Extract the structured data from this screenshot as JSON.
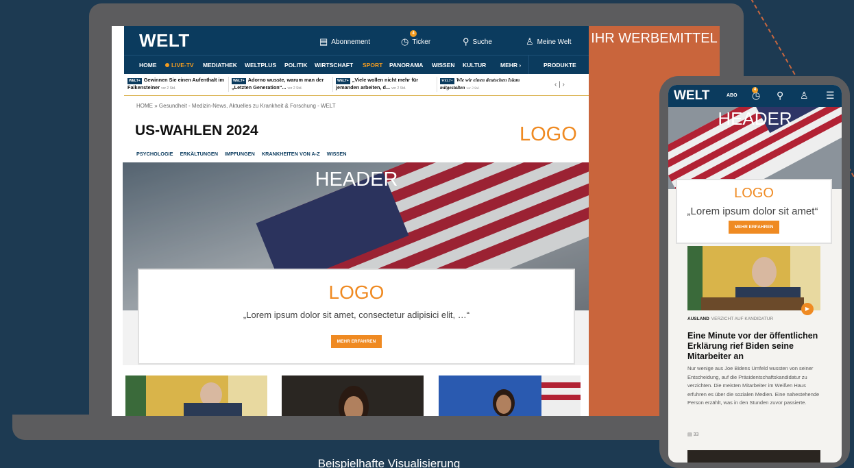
{
  "desktop": {
    "brand": "WELT",
    "tools": [
      {
        "label": "Abonnement",
        "icon": "subscription-icon"
      },
      {
        "label": "Ticker",
        "icon": "ticker-icon",
        "badge": "4"
      },
      {
        "label": "Suche",
        "icon": "search-icon"
      },
      {
        "label": "Meine Welt",
        "icon": "user-icon"
      }
    ],
    "nav": [
      "HOME",
      "LIVE-TV",
      "MEDIATHEK",
      "WELTPLUS",
      "POLITIK",
      "WIRTSCHAFT",
      "SPORT",
      "PANORAMA",
      "WISSEN",
      "KULTUR",
      "MEHR ›",
      "PRODUKTE"
    ],
    "teasers": [
      {
        "tag": "WELT+",
        "text": "Gewinnen Sie einen Aufenthalt im Falkensteiner",
        "time": "vor 2 Std."
      },
      {
        "tag": "WELT+",
        "text": "Adorno wusste, warum man der „Letzten Generation“...",
        "time": "vor 2 Std."
      },
      {
        "tag": "WELT+",
        "text": "„Viele wollen nicht mehr für jemanden arbeiten, d...",
        "time": "vor 2 Std."
      },
      {
        "tag": "WELT+",
        "text": "Wie wir einen deutschen Islam mitgestalten",
        "time": "vor 3 Std."
      }
    ],
    "breadcrumb": "HOME » Gesundheit - Medizin-News, Aktuelles zu Krankheit & Forschung - WELT",
    "section_title": "US-WAHLEN 2024",
    "section_logo": "LOGO",
    "subnav": [
      "PSYCHOLOGIE",
      "ERKÄLTUNGEN",
      "IMPFUNGEN",
      "KRANKHEITEN VON A-Z",
      "WISSEN"
    ],
    "hero_label": "HEADER",
    "promo": {
      "logo": "LOGO",
      "text": "„Lorem ipsum dolor sit amet, consectetur adipisici elit, …“",
      "button": "MEHR ERFAHREN"
    },
    "ad_label": "IHR WERBEMITTEL"
  },
  "mobile": {
    "brand": "WELT",
    "abo": "ABO",
    "badge": "4",
    "hero_label": "HEADER",
    "promo": {
      "logo": "LOGO",
      "text": "„Lorem ipsum dolor sit amet“",
      "button": "MEHR ERFAHREN"
    },
    "article": {
      "kicker_section": "AUSLAND",
      "kicker_topic": "VERZICHT AUF KANDIDATUR",
      "headline": "Eine Minute vor der öffentlichen Erklärung rief Biden seine Mitarbeiter an",
      "body": "Nur wenige aus Joe Bidens Umfeld wussten von seiner Entscheidung, auf die Präsidentschaftskandidatur zu verzichten. Die meisten Mitarbeiter im Weißen Haus erfuhren es über die sozialen Medien. Eine nahestehende Person erzählt, was in den Stunden zuvor passierte.",
      "comments": "33"
    }
  },
  "caption": "Beispielhafte Visualisierung",
  "colors": {
    "navy": "#0b3b5e",
    "orange": "#ef8a22",
    "ad": "#c9653c",
    "background": "#1d3a52",
    "device": "#5c5c5e"
  }
}
